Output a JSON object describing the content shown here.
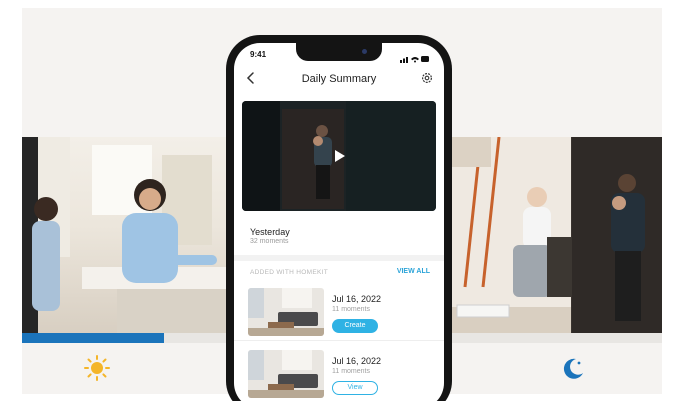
{
  "status": {
    "time": "9:41"
  },
  "nav": {
    "title": "Daily Summary",
    "back_icon": "chevron-left-icon",
    "settings_icon": "gear-icon"
  },
  "summary": {
    "title": "Yesterday",
    "subtitle": "32 moments"
  },
  "section": {
    "title": "ADDED WITH HOMEKIT",
    "link": "VIEW ALL"
  },
  "moments": [
    {
      "date": "Jul 16, 2022",
      "subtitle": "11 moments",
      "button": "Create"
    },
    {
      "date": "Jul 16, 2022",
      "subtitle": "11 moments",
      "button": "View"
    }
  ],
  "modes": {
    "day_icon": "sun-icon",
    "night_icon": "moon-icon"
  },
  "colors": {
    "accent": "#2fb2e4",
    "day_bar": "#1b74bb",
    "night_icon": "#1b74bb",
    "sun": "#f4b52a"
  }
}
